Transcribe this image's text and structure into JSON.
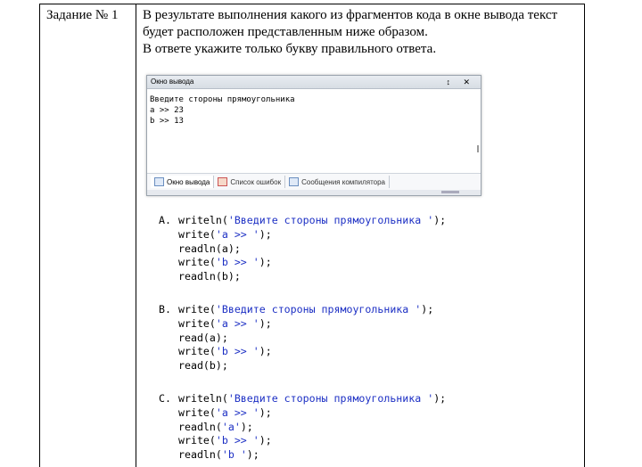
{
  "task": {
    "label": "Задание № 1",
    "text_line1": "В результате выполнения какого из фрагментов кода в окне вывода текст будет расположен представленным ниже образом.",
    "text_line2": "В ответе укажите только букву правильного ответа."
  },
  "output_window": {
    "title": "Окно вывода",
    "controls": "↕ ✕",
    "console_lines": [
      "Введите стороны прямоугольника",
      "a >> 23",
      "b >> 13"
    ],
    "tabs": [
      {
        "label": "Окно вывода",
        "active": true
      },
      {
        "label": "Список ошибок",
        "active": false
      },
      {
        "label": "Сообщения компилятора",
        "active": false
      }
    ]
  },
  "options": [
    {
      "letter": "A.",
      "lines": [
        {
          "fn": "writeln(",
          "str": "'Введите стороны прямоугольника '",
          "end": ");"
        },
        {
          "fn": "write(",
          "str": "'a >> '",
          "end": ");"
        },
        {
          "fn": "readln(a);",
          "str": "",
          "end": ""
        },
        {
          "fn": "write(",
          "str": "'b >> '",
          "end": ");"
        },
        {
          "fn": "readln(b);",
          "str": "",
          "end": ""
        }
      ]
    },
    {
      "letter": "B.",
      "lines": [
        {
          "fn": "write(",
          "str": "'Введите стороны прямоугольника '",
          "end": ");"
        },
        {
          "fn": "write(",
          "str": "'a >> '",
          "end": ");"
        },
        {
          "fn": "read(a);",
          "str": "",
          "end": ""
        },
        {
          "fn": "write(",
          "str": "'b >> '",
          "end": ");"
        },
        {
          "fn": "read(b);",
          "str": "",
          "end": ""
        }
      ]
    },
    {
      "letter": "C.",
      "lines": [
        {
          "fn": "writeln(",
          "str": "'Введите стороны прямоугольника '",
          "end": ");"
        },
        {
          "fn": "write(",
          "str": "'a >> '",
          "end": ");"
        },
        {
          "fn": "readln(",
          "str": "'a'",
          "end": ");"
        },
        {
          "fn": "write(",
          "str": "'b >> '",
          "end": ");"
        },
        {
          "fn": "readln(",
          "str": "'b '",
          "end": ");"
        }
      ]
    }
  ]
}
